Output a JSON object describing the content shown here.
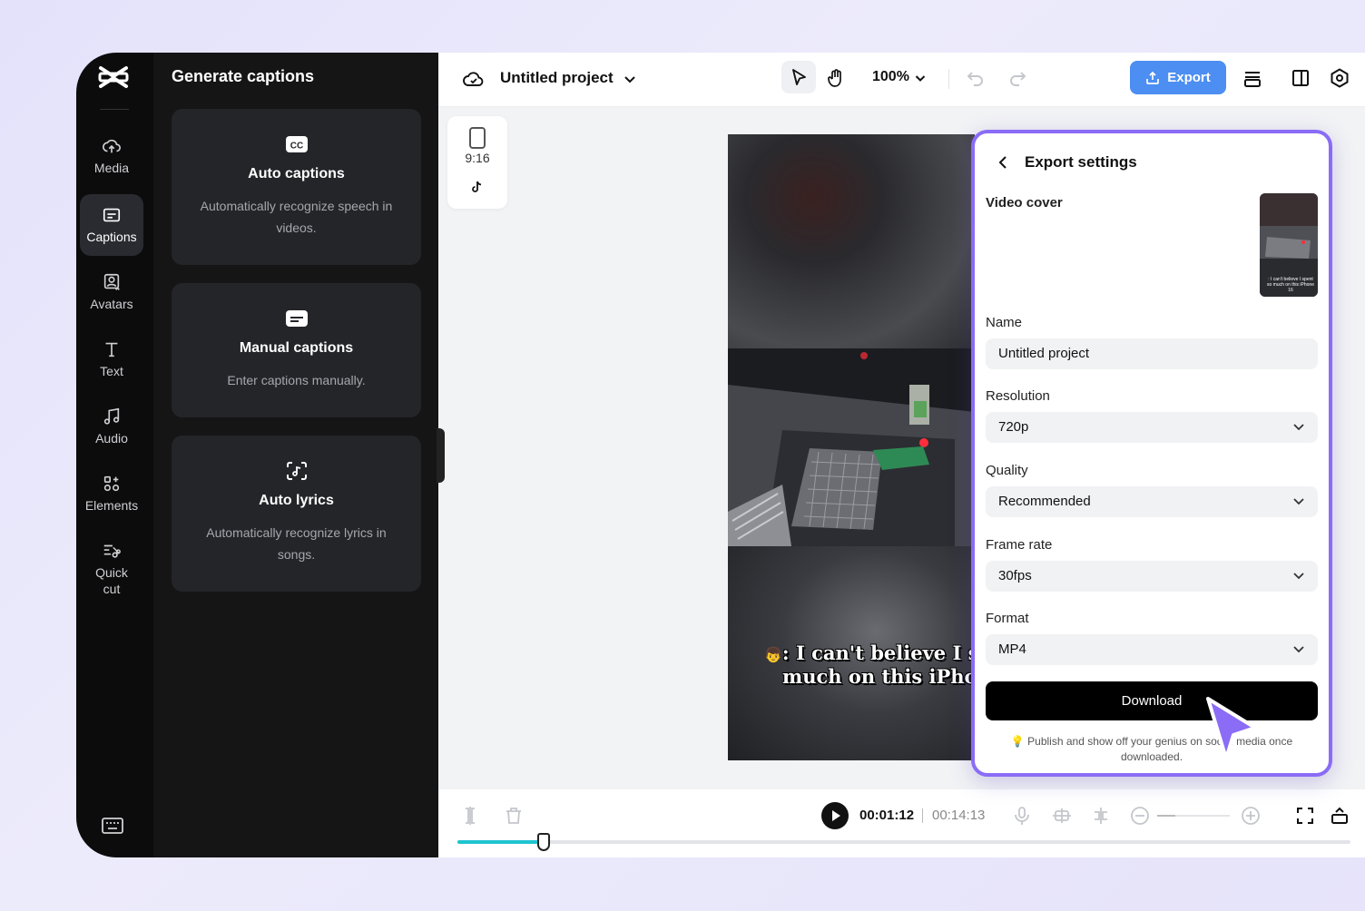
{
  "rail": {
    "items": [
      {
        "label": "Media",
        "icon": "cloud-upload-icon"
      },
      {
        "label": "Captions",
        "icon": "captions-icon"
      },
      {
        "label": "Avatars",
        "icon": "avatar-icon"
      },
      {
        "label": "Text",
        "icon": "text-icon"
      },
      {
        "label": "Audio",
        "icon": "music-icon"
      },
      {
        "label": "Elements",
        "icon": "elements-icon"
      },
      {
        "label": "Quick cut",
        "icon": "quick-cut-icon"
      }
    ]
  },
  "panel": {
    "title": "Generate captions",
    "cards": [
      {
        "title": "Auto captions",
        "desc": "Automatically recognize speech in videos."
      },
      {
        "title": "Manual captions",
        "desc": "Enter captions manually."
      },
      {
        "title": "Auto lyrics",
        "desc": "Automatically recognize lyrics in songs."
      }
    ]
  },
  "topbar": {
    "project_title": "Untitled project",
    "zoom": "100%",
    "export_label": "Export"
  },
  "canvas": {
    "ratio": "9:16",
    "subtitle_line1": ": I can't believe I sp",
    "subtitle_line2": "much on this iPhon"
  },
  "timeline": {
    "current_time": "00:01:12",
    "total_time": "00:14:13",
    "progress": 0.097
  },
  "export": {
    "title": "Export settings",
    "video_cover_label": "Video cover",
    "cover_caption": ": I can't believe I spent so much on this iPhone 16",
    "name_label": "Name",
    "name_value": "Untitled project",
    "resolution_label": "Resolution",
    "resolution_value": "720p",
    "quality_label": "Quality",
    "quality_value": "Recommended",
    "framerate_label": "Frame rate",
    "framerate_value": "30fps",
    "format_label": "Format",
    "format_value": "MP4",
    "download_label": "Download",
    "hint": "Publish and show off your genius on social media once downloaded."
  },
  "colors": {
    "accent": "#4c8ef2",
    "modal_border": "#8a6cf6",
    "progress": "#1ec3d0"
  }
}
